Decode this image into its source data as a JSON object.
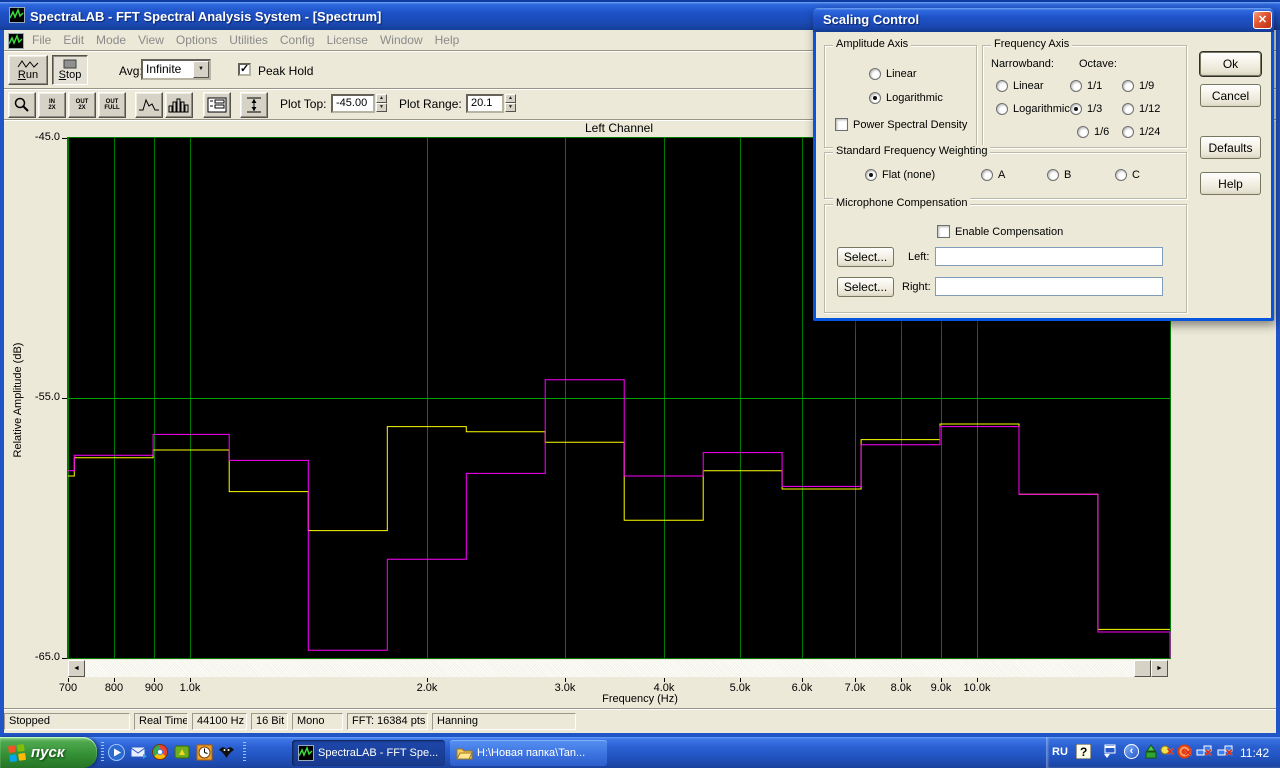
{
  "window": {
    "title": "SpectraLAB - FFT Spectral Analysis System - [Spectrum]"
  },
  "menu": {
    "items": [
      "File",
      "Edit",
      "Mode",
      "View",
      "Options",
      "Utilities",
      "Config",
      "License",
      "Window",
      "Help"
    ]
  },
  "toolbar": {
    "run": "Run",
    "stop": "Stop",
    "avg_label": "Avg:",
    "avg_value": "Infinite",
    "peak_hold_label": "Peak Hold",
    "peak_hold_checked": true,
    "zoom_buttons": [
      {
        "name": "zoom",
        "l1": "",
        "l2": ""
      },
      {
        "name": "zoom-in-2x",
        "l1": "IN",
        "l2": "2X"
      },
      {
        "name": "zoom-out-2x",
        "l1": "OUT",
        "l2": "2X"
      },
      {
        "name": "zoom-out-full",
        "l1": "OUT",
        "l2": "FULL"
      }
    ],
    "plot_top_label": "Plot Top:",
    "plot_top_value": "-45.00",
    "plot_range_label": "Plot Range:",
    "plot_range_value": "20.1"
  },
  "chart_data": {
    "type": "line",
    "step": true,
    "title": "Left Channel",
    "xlabel": "Frequency (Hz)",
    "ylabel": "Relative Amplitude (dB)",
    "x_scale": "log",
    "xlim": [
      700,
      17600
    ],
    "ylim": [
      -65,
      -45
    ],
    "plot_bg": "#000000",
    "grid": {
      "color": "#007A00",
      "h_line_color": "#00A400",
      "h_lines": [
        -55
      ]
    },
    "y_ticks": [
      {
        "value": -45,
        "label": "-45.0"
      },
      {
        "value": -55,
        "label": "-55.0"
      },
      {
        "value": -65,
        "label": "-65.0"
      }
    ],
    "x_ticks": [
      {
        "value": 700,
        "label": "700"
      },
      {
        "value": 800,
        "label": "800"
      },
      {
        "value": 900,
        "label": "900"
      },
      {
        "value": 1000,
        "label": "1.0k"
      },
      {
        "value": 2000,
        "label": "2.0k"
      },
      {
        "value": 3000,
        "label": "3.0k"
      },
      {
        "value": 4000,
        "label": "4.0k"
      },
      {
        "value": 5000,
        "label": "5.0k"
      },
      {
        "value": 6000,
        "label": "6.0k"
      },
      {
        "value": 7000,
        "label": "7.0k"
      },
      {
        "value": 8000,
        "label": "8.0k"
      },
      {
        "value": 9000,
        "label": "9.0k"
      },
      {
        "value": 10000,
        "label": "10.0k"
      }
    ],
    "band_centers_hz": [
      630,
      800,
      1000,
      1250,
      1600,
      2000,
      2500,
      3150,
      4000,
      5000,
      6300,
      8000,
      10000,
      12500,
      16000
    ],
    "band_edges_hz": [
      566,
      713,
      898,
      1122,
      1414,
      1782,
      2245,
      2828,
      3564,
      4490,
      5657,
      7127,
      8980,
      11314,
      14254,
      17960
    ],
    "series": [
      {
        "name": "current-spectrum",
        "color": "#FFFF00",
        "drop_to_floor_at_end": false,
        "values_db": [
          -58.0,
          -57.3,
          -57.0,
          -58.6,
          -60.1,
          -56.1,
          -56.3,
          -56.7,
          -59.7,
          -57.8,
          -58.5,
          -56.6,
          -56.0,
          -58.7,
          -63.9
        ]
      },
      {
        "name": "peak-hold",
        "color": "#FF00FF",
        "drop_to_floor_at_end": true,
        "values_db": [
          -57.8,
          -57.2,
          -56.4,
          -57.4,
          -64.7,
          -61.2,
          -57.9,
          -54.3,
          -58.0,
          -57.1,
          -58.4,
          -56.8,
          -56.1,
          -58.7,
          -64.0
        ]
      }
    ]
  },
  "dialog": {
    "title": "Scaling Control",
    "amplitude_axis": {
      "title": "Amplitude Axis",
      "linear": {
        "label": "Linear",
        "selected": false
      },
      "logarithmic": {
        "label": "Logarithmic",
        "selected": true
      },
      "psd": {
        "label": "Power Spectral Density",
        "checked": false
      }
    },
    "frequency_axis": {
      "title": "Frequency Axis",
      "narrowband_label": "Narrowband:",
      "octave_label": "Octave:",
      "nb_linear": {
        "label": "Linear",
        "selected": false
      },
      "nb_logarithmic": {
        "label": "Logarithmic",
        "selected": false
      },
      "oct_1_1": {
        "label": "1/1",
        "selected": false
      },
      "oct_1_9": {
        "label": "1/9",
        "selected": false
      },
      "oct_1_3": {
        "label": "1/3",
        "selected": true
      },
      "oct_1_12": {
        "label": "1/12",
        "selected": false
      },
      "oct_1_6": {
        "label": "1/6",
        "selected": false
      },
      "oct_1_24": {
        "label": "1/24",
        "selected": false
      }
    },
    "weighting": {
      "title": "Standard Frequency Weighting",
      "flat": {
        "label": "Flat (none)",
        "selected": true
      },
      "a": {
        "label": "A",
        "selected": false
      },
      "b": {
        "label": "B",
        "selected": false
      },
      "c": {
        "label": "C",
        "selected": false
      }
    },
    "mic": {
      "title": "Microphone Compensation",
      "enable": {
        "label": "Enable Compensation",
        "checked": false
      },
      "select_label": "Select...",
      "left_label": "Left:",
      "left_value": "",
      "right_label": "Right:",
      "right_value": ""
    },
    "ok": "Ok",
    "cancel": "Cancel",
    "defaults": "Defaults",
    "help": "Help"
  },
  "status_bar": {
    "panels": [
      "Stopped",
      "Real Time",
      "44100 Hz",
      "16 Bit",
      "Mono",
      "FFT: 16384 pts",
      "Hanning"
    ]
  },
  "taskbar": {
    "start": "пуск",
    "tasks": [
      {
        "label": "SpectraLAB - FFT Spe..."
      },
      {
        "label": "H:\\Новая папка\\Tan..."
      }
    ],
    "tray": {
      "lang": "RU",
      "time": "11:42"
    }
  }
}
